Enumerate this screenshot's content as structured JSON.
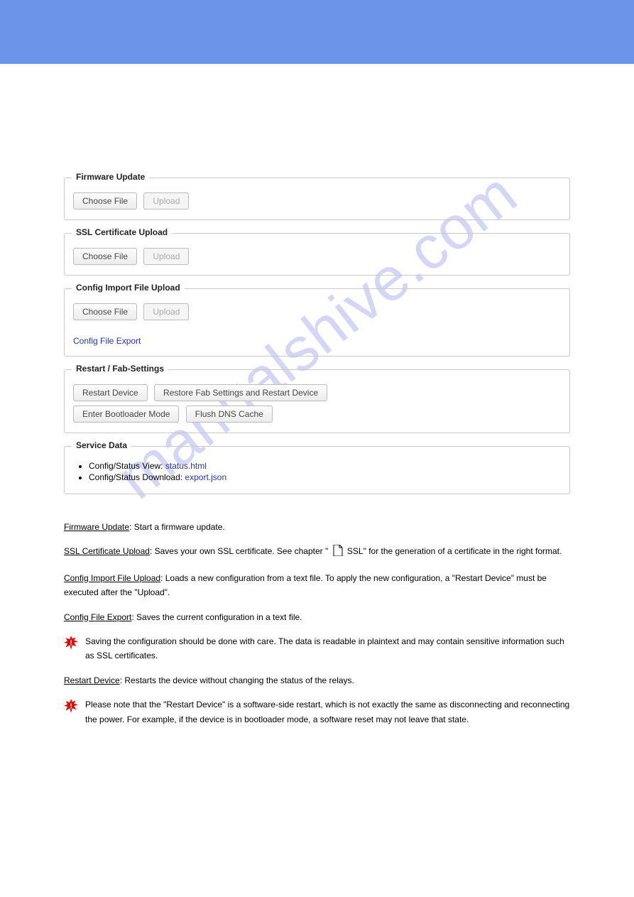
{
  "watermark": "manualshive.com",
  "panels": {
    "firmware": {
      "legend": "Firmware Update",
      "choose": "Choose File",
      "upload": "Upload"
    },
    "ssl": {
      "legend": "SSL Certificate Upload",
      "choose": "Choose File",
      "upload": "Upload"
    },
    "config": {
      "legend": "Config Import File Upload",
      "choose": "Choose File",
      "upload": "Upload",
      "export_link": "Config File Export"
    },
    "restart": {
      "legend": "Restart / Fab-Settings",
      "restart": "Restart Device",
      "restore": "Restore Fab Settings and Restart Device",
      "bootloader": "Enter Bootloader Mode",
      "flushdns": "Flush DNS Cache"
    },
    "service": {
      "legend": "Service Data",
      "item1_label": "Config/Status View:",
      "item1_link": "status.html",
      "item2_label": "Config/Status Download:",
      "item2_link": "export.json"
    }
  },
  "body": {
    "h1": "Firmware Update",
    "p1": ": Start a firmware update.",
    "h2": "SSL Certificate Upload",
    "p2a": ": Saves your own SSL certificate. See chapter \"",
    "p2b": " SSL\" for the generation of a certificate in the right format.",
    "h3": "Config Import File Upload",
    "p3": ": Loads a new configuration from a text file. To apply the new configuration, a \"Restart Device\" must be executed after the \"Upload\".",
    "h4": "Config File Export",
    "p4": ": Saves the current configuration in a text file.",
    "warn1": "Saving the configuration should be done with care. The data is readable in plaintext and may contain sensitive information such as SSL certificates.",
    "h5": "Restart Device",
    "p5": ": Restarts the device without changing the status of the relays.",
    "warn2": "Please note that the \"Restart Device\" is a software-side restart, which is not exactly the same as disconnecting and reconnecting the power. For example, if the device is in bootloader mode, a software reset may not leave that state."
  }
}
